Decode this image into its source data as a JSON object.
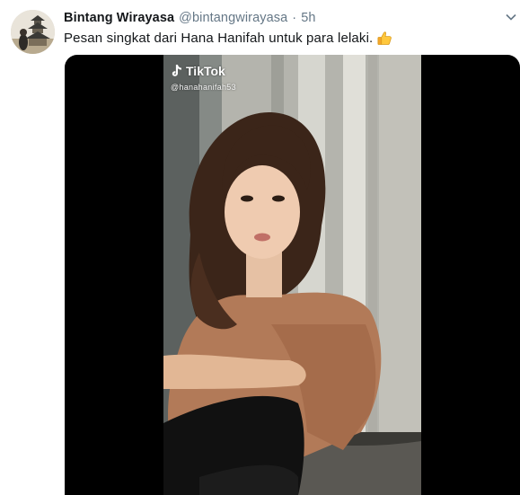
{
  "tweet": {
    "display_name": "Bintang Wirayasa",
    "handle": "@bintangwirayasa",
    "separator": "·",
    "time": "5h",
    "text": "Pesan singkat dari Hana Hanifah untuk para lelaki.",
    "emoji": "thumbs-up"
  },
  "media": {
    "watermark_brand": "TikTok",
    "watermark_user": "@hanahanifah53",
    "icons": [
      "tiktok-note-icon",
      "thumbs-up-emoji",
      "more-options-caret-icon"
    ]
  },
  "colors": {
    "name_text": "#14171a",
    "secondary_text": "#657786",
    "media_bg": "#000000"
  }
}
